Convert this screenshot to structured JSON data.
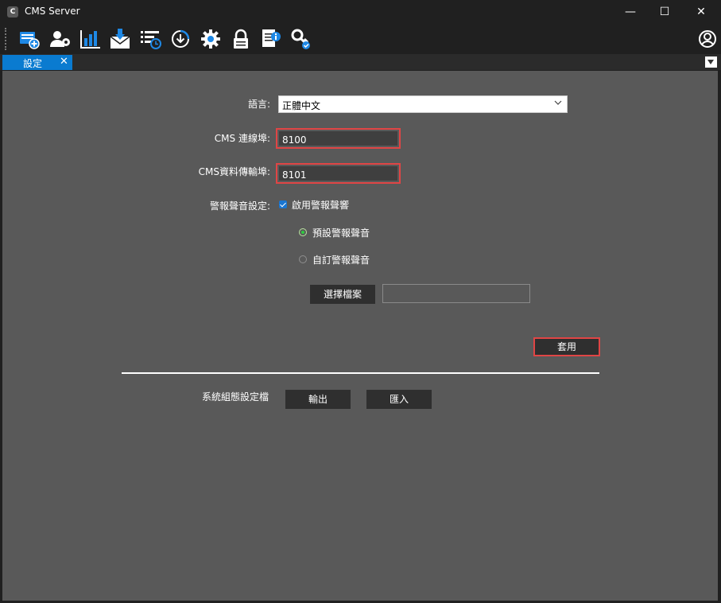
{
  "window": {
    "title": "CMS Server",
    "app_icon_glyph": "C",
    "minimize_glyph": "—",
    "maximize_glyph": "☐",
    "close_glyph": "✕"
  },
  "toolbar": {
    "icons": [
      "device-add-icon",
      "user-settings-icon",
      "bar-chart-icon",
      "mail-download-icon",
      "event-list-icon",
      "download-circle-icon",
      "gear-icon",
      "lock-icon",
      "document-info-icon",
      "key-check-icon",
      "user-circle-icon"
    ]
  },
  "tabs": [
    {
      "label": "設定",
      "close_glyph": "✕",
      "active": true
    }
  ],
  "settings": {
    "language_label": "語言:",
    "language_value": "正體中文",
    "cms_port_label": "CMS 連線埠:",
    "cms_port_value": "8100",
    "cms_data_port_label": "CMS資料傳輸埠:",
    "cms_data_port_value": "8101",
    "alarm_sound_label": "警報聲音設定:",
    "enable_alarm_label": "啟用警報聲響",
    "enable_alarm_checked": true,
    "default_alarm_label": "預設警報聲音",
    "custom_alarm_label": "自訂警報聲音",
    "selected_alarm": "default",
    "choose_file_label": "選擇檔案",
    "file_path_value": "",
    "apply_label": "套用",
    "system_config_label": "系統組態設定檔",
    "export_label": "輸出",
    "import_label": "匯入"
  },
  "colors": {
    "accent_blue": "#0a7bd0",
    "highlight_red": "#e04545",
    "content_bg": "#595959",
    "radio_green": "#2ecc40"
  }
}
